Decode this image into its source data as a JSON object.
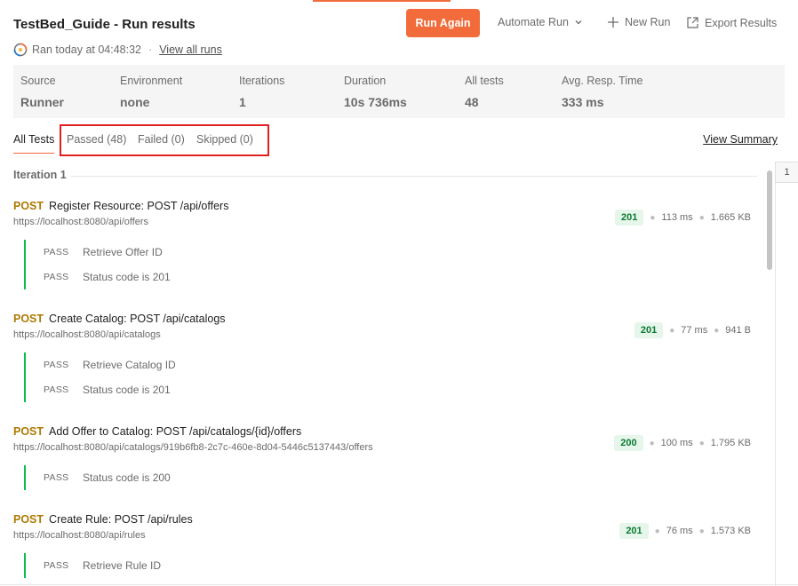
{
  "header": {
    "title": "TestBed_Guide - Run results",
    "run_again": "Run Again",
    "automate_run": "Automate Run",
    "new_run": "New Run",
    "export_results": "Export Results"
  },
  "subline": {
    "ran_text": "Ran today at 04:48:32",
    "separator": "·",
    "view_all_runs": "View all runs"
  },
  "stats": [
    {
      "label": "Source",
      "value": "Runner"
    },
    {
      "label": "Environment",
      "value": "none"
    },
    {
      "label": "Iterations",
      "value": "1"
    },
    {
      "label": "Duration",
      "value": "10s 736ms"
    },
    {
      "label": "All tests",
      "value": "48"
    },
    {
      "label": "Avg. Resp. Time",
      "value": "333 ms"
    }
  ],
  "tabs": {
    "all": "All Tests",
    "passed": "Passed (48)",
    "failed": "Failed (0)",
    "skipped": "Skipped (0)",
    "view_summary": "View Summary"
  },
  "iteration_label": "Iteration 1",
  "page_number": "1",
  "requests": [
    {
      "method": "POST",
      "name": "Register Resource: POST /api/offers",
      "url": "https://localhost:8080/api/offers",
      "status": "201",
      "time": "113 ms",
      "size": "1.665 KB",
      "tests": [
        {
          "result": "PASS",
          "name": "Retrieve Offer ID"
        },
        {
          "result": "PASS",
          "name": "Status code is 201"
        }
      ]
    },
    {
      "method": "POST",
      "name": "Create Catalog: POST /api/catalogs",
      "url": "https://localhost:8080/api/catalogs",
      "status": "201",
      "time": "77 ms",
      "size": "941 B",
      "tests": [
        {
          "result": "PASS",
          "name": "Retrieve Catalog ID"
        },
        {
          "result": "PASS",
          "name": "Status code is 201"
        }
      ]
    },
    {
      "method": "POST",
      "name": "Add Offer to Catalog: POST /api/catalogs/{id}/offers",
      "url": "https://localhost:8080/api/catalogs/919b6fb8-2c7c-460e-8d04-5446c5137443/offers",
      "status": "200",
      "time": "100 ms",
      "size": "1.795 KB",
      "tests": [
        {
          "result": "PASS",
          "name": "Status code is 200"
        }
      ]
    },
    {
      "method": "POST",
      "name": "Create Rule: POST /api/rules",
      "url": "https://localhost:8080/api/rules",
      "status": "201",
      "time": "76 ms",
      "size": "1.573 KB",
      "tests": [
        {
          "result": "PASS",
          "name": "Retrieve Rule ID"
        }
      ]
    }
  ],
  "colors": {
    "accent": "#f26b3a",
    "method_post": "#ad7a03",
    "pass_bar": "#0cbb52",
    "status_badge_bg": "#e7f6ea",
    "highlight_box": "#e02020"
  }
}
